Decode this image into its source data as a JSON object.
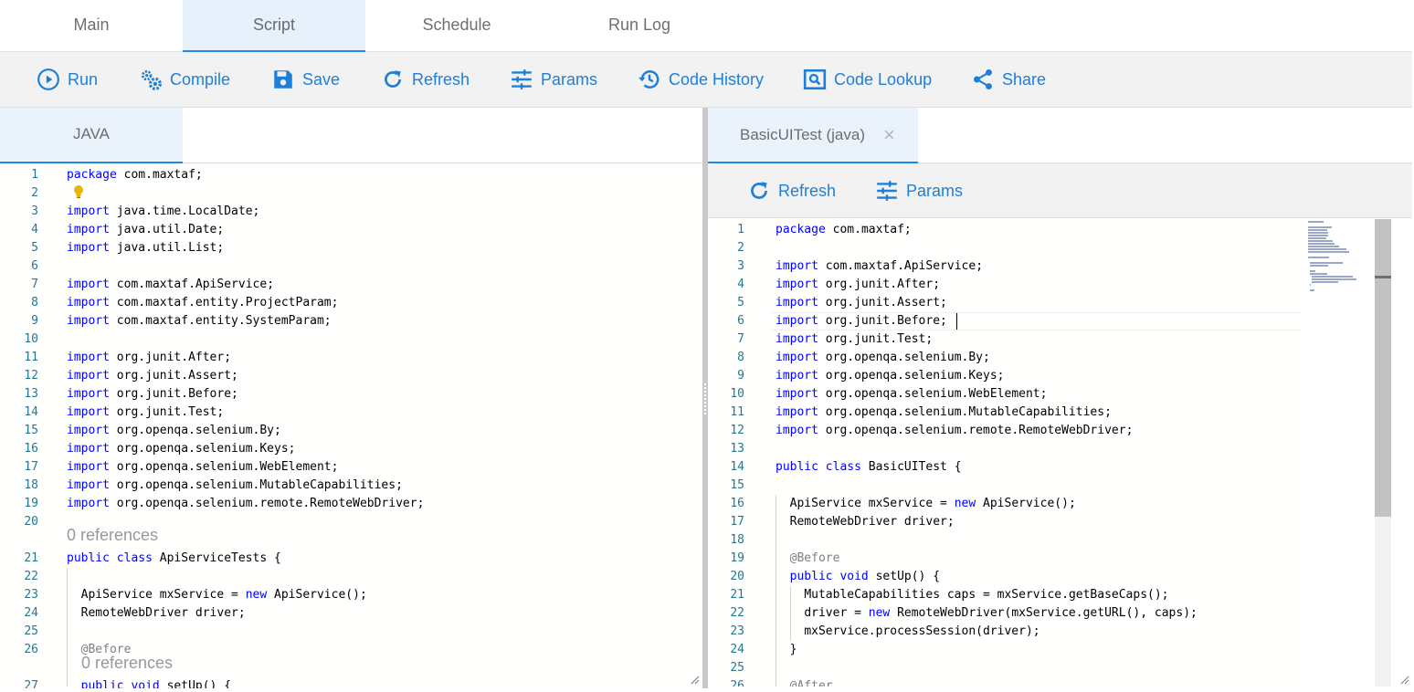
{
  "tabs": [
    "Main",
    "Script",
    "Schedule",
    "Run Log"
  ],
  "toolbar": {
    "run": "Run",
    "compile": "Compile",
    "save": "Save",
    "refresh": "Refresh",
    "params": "Params",
    "code_history": "Code History",
    "code_lookup": "Code Lookup",
    "share": "Share"
  },
  "left_panel": {
    "language_tab": "JAVA",
    "lines": [
      {
        "n": "1",
        "code": "package com.maxtaf;"
      },
      {
        "n": "2",
        "code": ""
      },
      {
        "n": "3",
        "code": "import java.time.LocalDate;"
      },
      {
        "n": "4",
        "code": "import java.util.Date;"
      },
      {
        "n": "5",
        "code": "import java.util.List;"
      },
      {
        "n": "6",
        "code": ""
      },
      {
        "n": "7",
        "code": "import com.maxtaf.ApiService;"
      },
      {
        "n": "8",
        "code": "import com.maxtaf.entity.ProjectParam;"
      },
      {
        "n": "9",
        "code": "import com.maxtaf.entity.SystemParam;"
      },
      {
        "n": "10",
        "code": ""
      },
      {
        "n": "11",
        "code": "import org.junit.After;"
      },
      {
        "n": "12",
        "code": "import org.junit.Assert;"
      },
      {
        "n": "13",
        "code": "import org.junit.Before;"
      },
      {
        "n": "14",
        "code": "import org.junit.Test;"
      },
      {
        "n": "15",
        "code": "import org.openqa.selenium.By;"
      },
      {
        "n": "16",
        "code": "import org.openqa.selenium.Keys;"
      },
      {
        "n": "17",
        "code": "import org.openqa.selenium.WebElement;"
      },
      {
        "n": "18",
        "code": "import org.openqa.selenium.MutableCapabilities;"
      },
      {
        "n": "19",
        "code": "import org.openqa.selenium.remote.RemoteWebDriver;"
      },
      {
        "n": "20",
        "code": ""
      },
      {
        "n": "21",
        "code": "public class ApiServiceTests {"
      },
      {
        "n": "22",
        "code": ""
      },
      {
        "n": "23",
        "code": "  ApiService mxService = new ApiService();"
      },
      {
        "n": "24",
        "code": "  RemoteWebDriver driver;"
      },
      {
        "n": "25",
        "code": ""
      },
      {
        "n": "26",
        "code": "  @Before"
      },
      {
        "n": "27",
        "code": "  public void setUp() {"
      }
    ],
    "code_lens_1": "0 references",
    "code_lens_2": "0 references"
  },
  "right_panel": {
    "file_tab": "BasicUITest (java)",
    "close_glyph": "×",
    "toolbar": {
      "refresh": "Refresh",
      "params": "Params"
    },
    "lines": [
      {
        "n": "1",
        "code": "package com.maxtaf;"
      },
      {
        "n": "2",
        "code": ""
      },
      {
        "n": "3",
        "code": "import com.maxtaf.ApiService;"
      },
      {
        "n": "4",
        "code": "import org.junit.After;"
      },
      {
        "n": "5",
        "code": "import org.junit.Assert;"
      },
      {
        "n": "6",
        "code": "import org.junit.Before;"
      },
      {
        "n": "7",
        "code": "import org.junit.Test;"
      },
      {
        "n": "8",
        "code": "import org.openqa.selenium.By;"
      },
      {
        "n": "9",
        "code": "import org.openqa.selenium.Keys;"
      },
      {
        "n": "10",
        "code": "import org.openqa.selenium.WebElement;"
      },
      {
        "n": "11",
        "code": "import org.openqa.selenium.MutableCapabilities;"
      },
      {
        "n": "12",
        "code": "import org.openqa.selenium.remote.RemoteWebDriver;"
      },
      {
        "n": "13",
        "code": ""
      },
      {
        "n": "14",
        "code": "public class BasicUITest {"
      },
      {
        "n": "15",
        "code": ""
      },
      {
        "n": "16",
        "code": "  ApiService mxService = new ApiService();"
      },
      {
        "n": "17",
        "code": "  RemoteWebDriver driver;"
      },
      {
        "n": "18",
        "code": ""
      },
      {
        "n": "19",
        "code": "  @Before"
      },
      {
        "n": "20",
        "code": "  public void setUp() {"
      },
      {
        "n": "21",
        "code": "    MutableCapabilities caps = mxService.getBaseCaps();"
      },
      {
        "n": "22",
        "code": "    driver = new RemoteWebDriver(mxService.getURL(), caps);"
      },
      {
        "n": "23",
        "code": "    mxService.processSession(driver);"
      },
      {
        "n": "24",
        "code": "  }"
      },
      {
        "n": "25",
        "code": ""
      },
      {
        "n": "26",
        "code": "  @After"
      }
    ]
  },
  "colors": {
    "accent": "#1e7fd8",
    "active_tab_bg": "#e6f1fb",
    "toolbar_bg": "#f2f2f2",
    "keyword": "#0000ff",
    "line_number": "#237893",
    "annotation": "#808080",
    "lightbulb": "#e6b800"
  },
  "icons": {
    "run": "play-circle-icon",
    "compile": "gears-icon",
    "save": "floppy-disk-icon",
    "refresh": "refresh-icon",
    "params": "sliders-icon",
    "code_history": "history-icon",
    "code_lookup": "search-box-icon",
    "share": "share-icon",
    "lightbulb": "lightbulb-icon",
    "close": "close-icon"
  }
}
